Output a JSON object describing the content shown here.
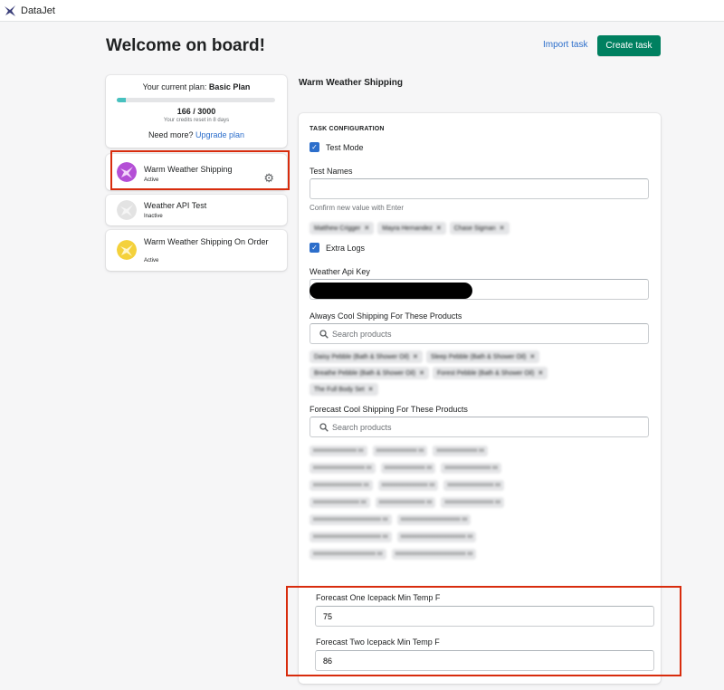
{
  "app": {
    "title": "DataJet"
  },
  "header": {
    "page_title": "Welcome on board!",
    "import_label": "Import task",
    "create_label": "Create task"
  },
  "plan": {
    "prefix": "Your current plan:",
    "name": "Basic Plan",
    "credits_used": "166",
    "credits_total": "3000",
    "credits_text": "166 / 3000",
    "progress_fraction": 0.055,
    "reset_text": "Your credits reset in 8 days",
    "need_more": "Need more?",
    "upgrade_link": "Upgrade plan"
  },
  "tasks": [
    {
      "name": "Warm Weather Shipping",
      "status": "Active",
      "icon": "purple-brand-icon"
    },
    {
      "name": "Weather API Test",
      "status": "Inactive",
      "icon": "gray-brand-icon"
    },
    {
      "name": "Warm Weather Shipping On Order",
      "status": "Active",
      "icon": "yellow-brand-icon"
    }
  ],
  "selected_task": "Warm Weather Shipping",
  "config": {
    "heading": "TASK CONFIGURATION",
    "test_mode_label": "Test Mode",
    "test_names_label": "Test Names",
    "test_names_help": "Confirm new value with Enter",
    "test_names_tags": [
      "Matthew Crigger",
      "Mayra Hernandez",
      "Chase Sigman"
    ],
    "extra_logs_label": "Extra Logs",
    "api_key_label": "Weather Api Key",
    "always_cool_label": "Always Cool Shipping For These Products",
    "search_placeholder": "Search products",
    "always_cool_tags": [
      "Daisy Pebble (Bath & Shower Oil)",
      "Sleep Pebble (Bath & Shower Oil)",
      "Breathe Pebble (Bath & Shower Oil)",
      "Forest Pebble (Bath & Shower Oil)",
      "The Full Body Set"
    ],
    "forecast_cool_label": "Forecast Cool Shipping For These Products",
    "forecast_cool_placeholder": "Search products",
    "forecast_one_label": "Forecast One Icepack Min Temp F",
    "forecast_one_value": "75",
    "forecast_two_label": "Forecast Two Icepack Min Temp F",
    "forecast_two_value": "86"
  },
  "colors": {
    "accent": "#008060",
    "link": "#2c6ecb",
    "highlight": "#d82c0d",
    "progress": "#47c1bf"
  }
}
